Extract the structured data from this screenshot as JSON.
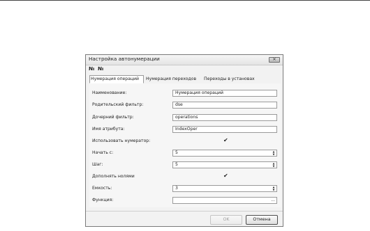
{
  "dialog": {
    "title": "Настройка автонумерации",
    "close_glyph": "✕",
    "toolbar": [
      {
        "icon": "numbering-add-icon",
        "glyph": "№"
      },
      {
        "icon": "numbering-icon",
        "glyph": "№"
      }
    ],
    "tabs": [
      {
        "label": "Нумерация операций",
        "active": true
      },
      {
        "label": "Нумерация переходов",
        "active": false
      },
      {
        "label": "Переходы в установах",
        "active": false
      }
    ],
    "fields": {
      "name": {
        "label": "Наименование:",
        "value": "Нумерация операций"
      },
      "parent_filter": {
        "label": "Родительский фильтр:",
        "value": "dse"
      },
      "child_filter": {
        "label": "Дочерний фильтр:",
        "value": "operations"
      },
      "attribute_name": {
        "label": "Имя атрибута:",
        "value": "IndexOper"
      },
      "use_numerator": {
        "label": "Использовать нумератор:",
        "checked": true,
        "glyph": "✔"
      },
      "start": {
        "label": "Начать с:",
        "value": "5"
      },
      "step": {
        "label": "Шаг:",
        "value": "5"
      },
      "pad_zeros": {
        "label": "Дополнять нолями",
        "checked": true,
        "glyph": "✔"
      },
      "capacity": {
        "label": "Емкость:",
        "value": "3"
      },
      "function": {
        "label": "Функция:",
        "value": "",
        "button": "..."
      }
    },
    "spinner_up": "▲",
    "spinner_down": "▼",
    "buttons": {
      "ok": "OK",
      "cancel": "Отмена"
    }
  }
}
